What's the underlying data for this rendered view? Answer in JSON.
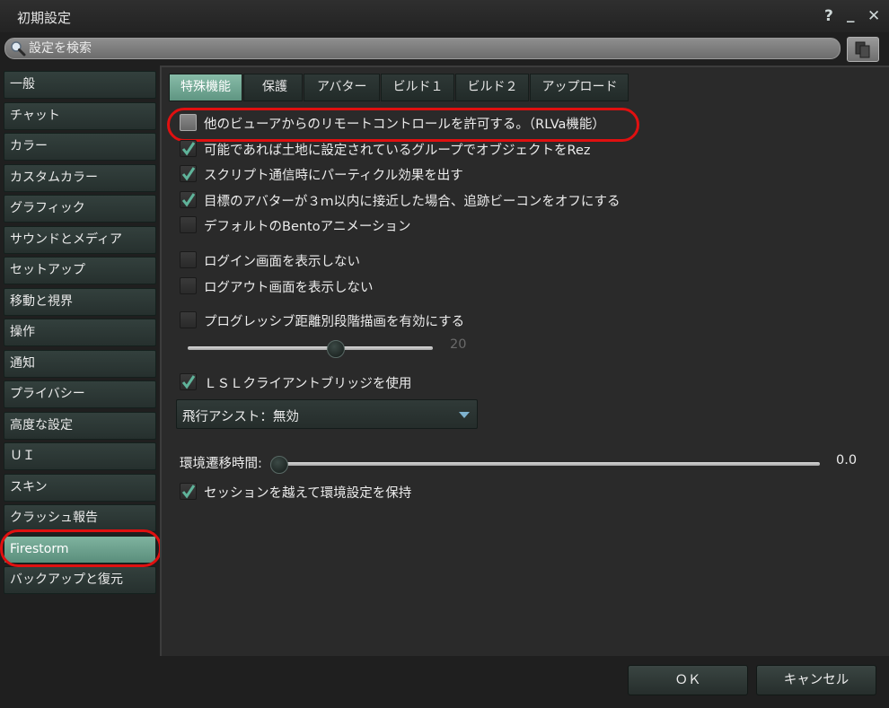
{
  "window": {
    "title": "初期設定",
    "help": "?",
    "minimize": "_",
    "close": "✕"
  },
  "search": {
    "placeholder": "設定を検索"
  },
  "sidebar": {
    "items": [
      {
        "label": "一般"
      },
      {
        "label": "チャット"
      },
      {
        "label": "カラー"
      },
      {
        "label": "カスタムカラー"
      },
      {
        "label": "グラフィック"
      },
      {
        "label": "サウンドとメディア"
      },
      {
        "label": "セットアップ"
      },
      {
        "label": "移動と視界"
      },
      {
        "label": "操作"
      },
      {
        "label": "通知"
      },
      {
        "label": "プライバシー"
      },
      {
        "label": "高度な設定"
      },
      {
        "label": "ＵＩ"
      },
      {
        "label": "スキン"
      },
      {
        "label": "クラッシュ報告"
      },
      {
        "label": "Firestorm",
        "selected": true
      },
      {
        "label": "バックアップと復元"
      }
    ]
  },
  "tabs": [
    {
      "label": "特殊機能",
      "active": true
    },
    {
      "label": "保護"
    },
    {
      "label": "アバター"
    },
    {
      "label": "ビルド１"
    },
    {
      "label": "ビルド２"
    },
    {
      "label": "アップロード"
    }
  ],
  "options": {
    "remote_control": {
      "label": "他のビューアからのリモートコントロールを許可する。（RLVa機能）",
      "checked": false
    },
    "rez_group": {
      "label": "可能であれば土地に設定されているグループでオブジェクトをRez",
      "checked": true
    },
    "script_particles": {
      "label": "スクリプト通信時にパーティクル効果を出す",
      "checked": true
    },
    "tracking_beacon": {
      "label": "目標のアバターが３ｍ以内に接近した場合、追跡ビーコンをオフにする",
      "checked": true
    },
    "bento_anim": {
      "label": "デフォルトのBentoアニメーション",
      "checked": false
    },
    "hide_login": {
      "label": "ログイン画面を表示しない",
      "checked": false
    },
    "hide_logout": {
      "label": "ログアウト画面を表示しない",
      "checked": false
    },
    "progressive_draw": {
      "label": "プログレッシブ距離別段階描画を有効にする",
      "checked": false
    },
    "lsl_bridge": {
      "label": "ＬＳＬクライアントブリッジを使用",
      "checked": true
    },
    "keep_env": {
      "label": "セッションを越えて環境設定を保持",
      "checked": true
    }
  },
  "progressive_slider": {
    "value": "20",
    "fraction": 0.6
  },
  "flight_assist": {
    "selected": "飛行アシスト：無効"
  },
  "env_transition": {
    "label": "環境遷移時間:",
    "value": "0.0",
    "fraction": 0.0
  },
  "footer": {
    "ok_label": "ＯＫ",
    "cancel_label": "キャンセル"
  },
  "colors": {
    "accent": "#6fa893",
    "highlight_ring": "#e01010"
  }
}
